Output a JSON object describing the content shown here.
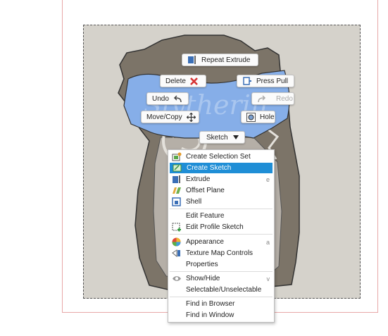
{
  "marking_menu": {
    "repeat_extrude": "Repeat Extrude",
    "delete": "Delete",
    "press_pull": "Press Pull",
    "undo": "Undo",
    "redo": "Redo",
    "move_copy": "Move/Copy",
    "hole": "Hole",
    "sketch": "Sketch"
  },
  "context_menu": {
    "items": [
      {
        "label": "Create Selection Set",
        "icon": "selection-set-icon",
        "shortcut": ""
      },
      {
        "label": "Create Sketch",
        "icon": "create-sketch-icon",
        "shortcut": "",
        "highlighted": true
      },
      {
        "label": "Extrude",
        "icon": "extrude-icon",
        "shortcut": "e"
      },
      {
        "label": "Offset Plane",
        "icon": "offset-plane-icon",
        "shortcut": ""
      },
      {
        "label": "Shell",
        "icon": "shell-icon",
        "shortcut": ""
      },
      {
        "label": "Edit Feature",
        "icon": "",
        "shortcut": ""
      },
      {
        "label": "Edit Profile Sketch",
        "icon": "edit-profile-sketch-icon",
        "shortcut": ""
      },
      {
        "label": "Appearance",
        "icon": "appearance-icon",
        "shortcut": "a"
      },
      {
        "label": "Texture Map Controls",
        "icon": "texture-map-icon",
        "shortcut": ""
      },
      {
        "label": "Properties",
        "icon": "",
        "shortcut": ""
      },
      {
        "label": "Show/Hide",
        "icon": "eye-icon",
        "shortcut": "v"
      },
      {
        "label": "Selectable/Unselectable",
        "icon": "",
        "shortcut": ""
      },
      {
        "label": "Find in Browser",
        "icon": "",
        "shortcut": ""
      },
      {
        "label": "Find in Window",
        "icon": "",
        "shortcut": ""
      }
    ]
  },
  "model": {
    "banner_text": "Slytherin",
    "colors": {
      "banner": "#86aee8",
      "shield_outer": "#7c7468",
      "shield_inner": "#b5afa7",
      "canvas": "#d5d2cb",
      "highlight": "#1f8ed6"
    }
  }
}
